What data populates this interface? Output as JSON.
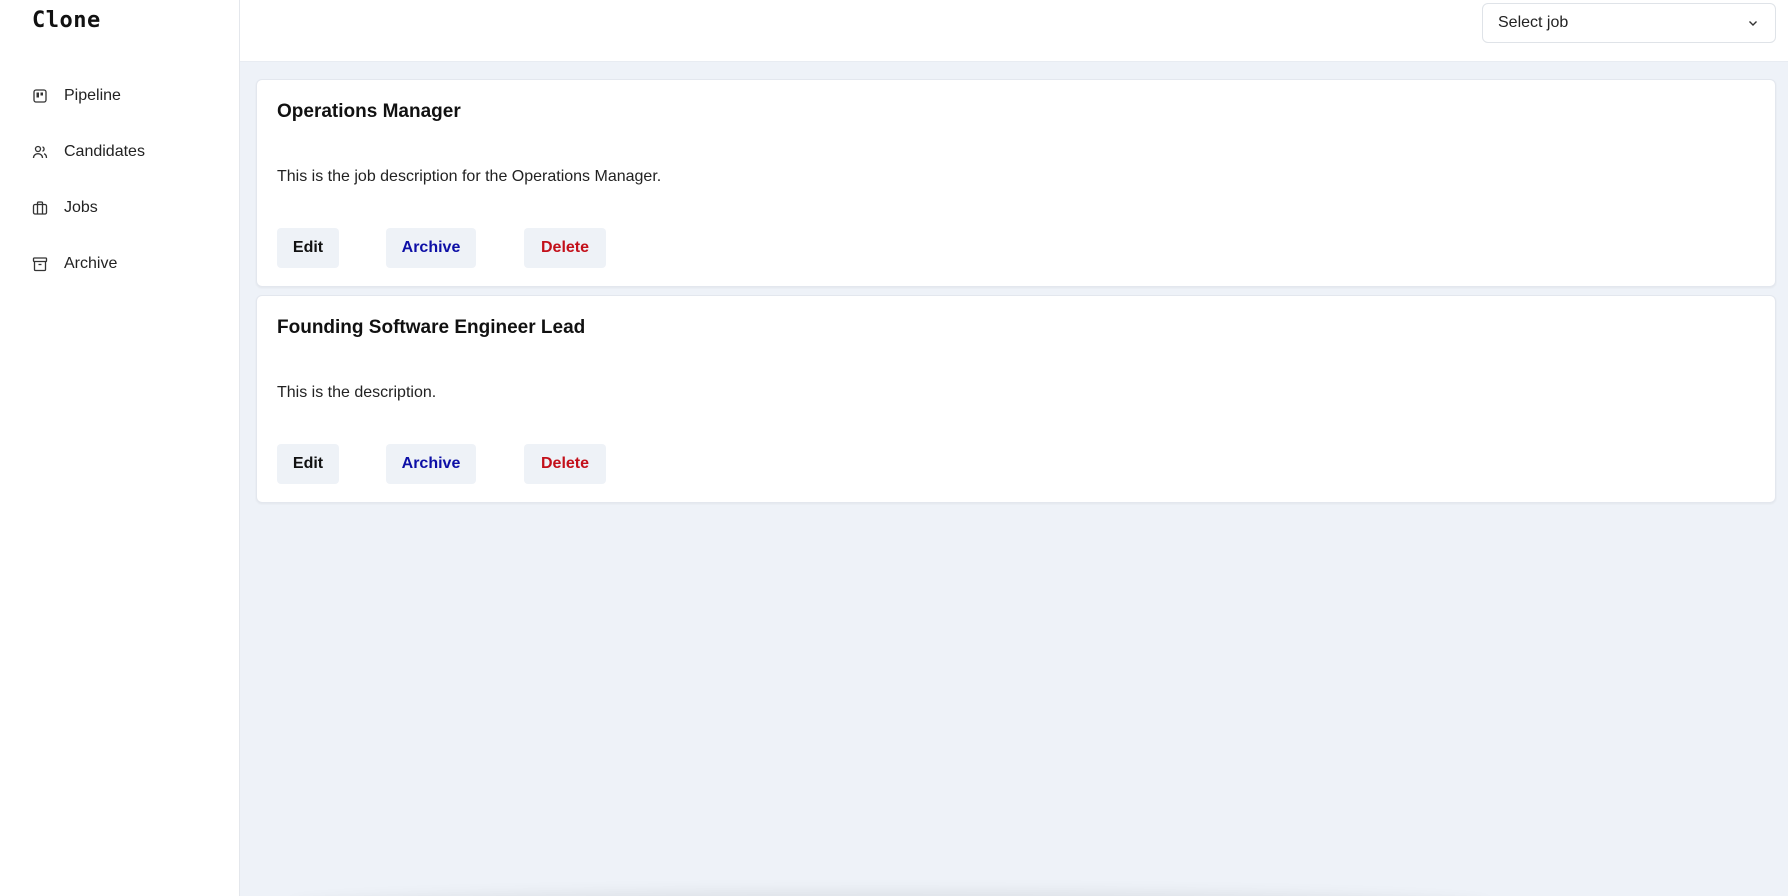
{
  "app": {
    "logo": "Clone"
  },
  "sidebar": {
    "items": [
      {
        "label": "Pipeline",
        "icon": "pipeline-icon"
      },
      {
        "label": "Candidates",
        "icon": "users-icon"
      },
      {
        "label": "Jobs",
        "icon": "briefcase-icon"
      },
      {
        "label": "Archive",
        "icon": "archive-icon"
      }
    ]
  },
  "header": {
    "job_select": {
      "value": "Select job",
      "icon": "chevron-down-icon"
    }
  },
  "jobs": [
    {
      "title": "Operations Manager",
      "description": "This is the job description for the Operations Manager.",
      "actions": {
        "edit": "Edit",
        "archive": "Archive",
        "delete": "Delete"
      }
    },
    {
      "title": "Founding Software Engineer Lead",
      "description": "This is the description.",
      "actions": {
        "edit": "Edit",
        "archive": "Archive",
        "delete": "Delete"
      }
    }
  ],
  "colors": {
    "main_bg": "#eef2f8",
    "archive_text": "#0d0fa6",
    "delete_text": "#c3101a",
    "button_bg": "#eef2f7"
  }
}
